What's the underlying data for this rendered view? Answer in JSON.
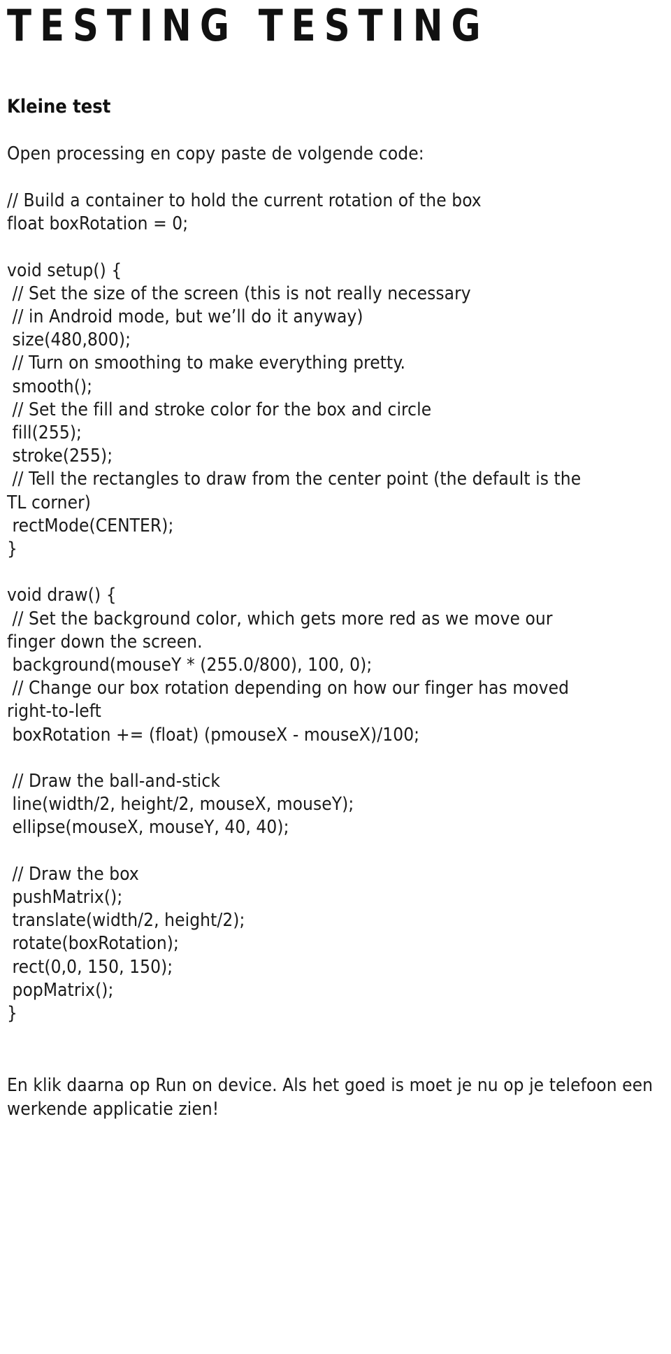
{
  "document": {
    "title": "TESTING TESTING",
    "sub_heading": "Kleine test",
    "intro": "Open processing en copy paste de volgende code:",
    "outro": "En klik daarna op Run on device. Als het goed is moet je nu op je telefoon een werkende applicatie zien!",
    "text_color": "#1a1a1a",
    "background_color": "#ffffff"
  },
  "code": {
    "language": "Processing",
    "lines": [
      "// Build a container to hold the current rotation of the box",
      "float boxRotation = 0;",
      "",
      "void setup() {",
      " // Set the size of the screen (this is not really necessary",
      " // in Android mode, but we’ll do it anyway)",
      " size(480,800);",
      " // Turn on smoothing to make everything pretty.",
      " smooth();",
      " // Set the fill and stroke color for the box and circle",
      " fill(255);",
      " stroke(255);",
      " // Tell the rectangles to draw from the center point (the default is the",
      "TL corner)",
      " rectMode(CENTER);",
      "}",
      "",
      "void draw() {",
      " // Set the background color, which gets more red as we move our",
      "finger down the screen.",
      " background(mouseY * (255.0/800), 100, 0);",
      " // Change our box rotation depending on how our finger has moved",
      "right-to-left",
      " boxRotation += (float) (pmouseX - mouseX)/100;",
      "",
      " // Draw the ball-and-stick",
      " line(width/2, height/2, mouseX, mouseY);",
      " ellipse(mouseX, mouseY, 40, 40);",
      "",
      " // Draw the box",
      " pushMatrix();",
      " translate(width/2, height/2);",
      " rotate(boxRotation);",
      " rect(0,0, 150, 150);",
      " popMatrix();",
      "}"
    ]
  }
}
